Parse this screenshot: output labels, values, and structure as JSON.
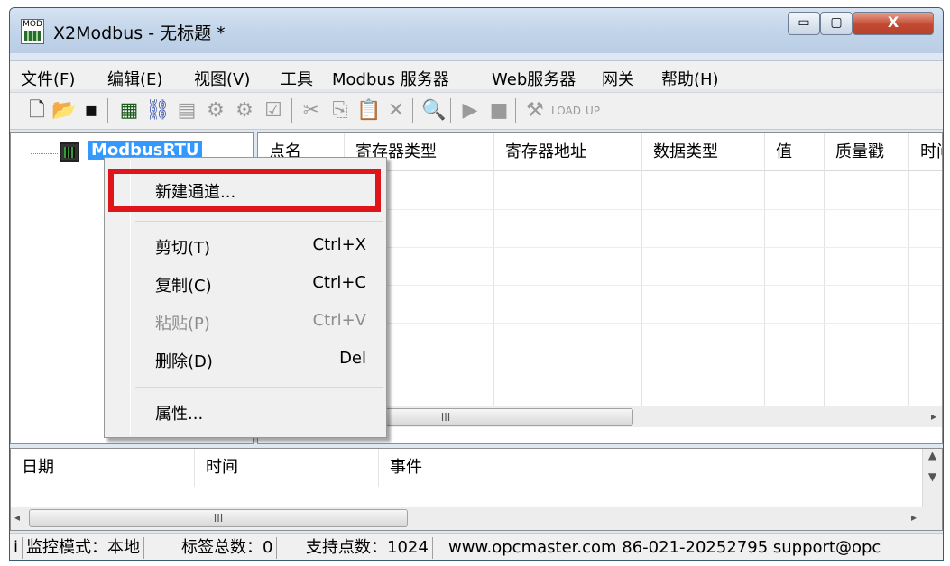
{
  "window": {
    "app_icon_text": "MOD",
    "title": "X2Modbus - 无标题 *",
    "buttons": {
      "minimize": "▭",
      "maximize": "▢",
      "close": "X"
    }
  },
  "menubar": [
    "文件(F)",
    "编辑(E)",
    "视图(V)",
    "工具",
    "Modbus 服务器",
    "Web服务器",
    "网关",
    "帮助(H)"
  ],
  "toolbar": {
    "icons": [
      "new-file-icon",
      "open-folder-icon",
      "save-icon",
      "add-device-icon",
      "add-channel-icon",
      "add-tag-icon",
      "batch-add-icon",
      "device-config-icon",
      "properties-icon",
      "cut-icon",
      "copy-icon",
      "paste-icon",
      "delete-icon",
      "monitor-icon",
      "start-icon",
      "stop-icon",
      "tools-icon",
      "load-icon",
      "unload-icon"
    ]
  },
  "tree": {
    "root_label": "ModbusRTU"
  },
  "grid": {
    "columns": [
      "点名",
      "寄存器类型",
      "寄存器地址",
      "数据类型",
      "值",
      "质量戳",
      "时间"
    ],
    "scroll_glyph": "III",
    "arrow_right": "▸"
  },
  "log": {
    "columns": [
      "日期",
      "时间",
      "事件"
    ],
    "scroll_glyph": "III",
    "arrow_up": "▲",
    "arrow_down": "▼",
    "arrow_left": "◂",
    "arrow_right": "▸"
  },
  "statusbar": {
    "prefix": "i",
    "monitor_mode": "监控模式：本地",
    "tag_count": "标签总数：0",
    "supported_points": "支持点数：1024",
    "contact": "www.opcmaster.com 86-021-20252795 support@opc"
  },
  "context_menu": {
    "items": [
      {
        "label": "新建通道...",
        "shortcut": "",
        "enabled": true
      },
      {
        "label": "剪切(T)",
        "shortcut": "Ctrl+X",
        "enabled": true
      },
      {
        "label": "复制(C)",
        "shortcut": "Ctrl+C",
        "enabled": true
      },
      {
        "label": "粘贴(P)",
        "shortcut": "Ctrl+V",
        "enabled": false
      },
      {
        "label": "删除(D)",
        "shortcut": "Del",
        "enabled": true
      },
      {
        "label": "属性...",
        "shortcut": "",
        "enabled": true
      }
    ],
    "highlight_color": "#e0151c"
  }
}
